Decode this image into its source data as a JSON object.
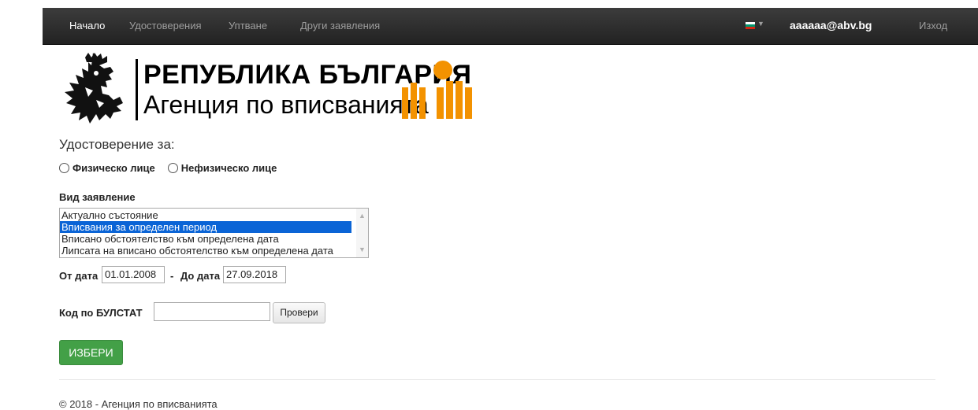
{
  "nav": {
    "items": [
      {
        "label": "Начало",
        "active": true
      },
      {
        "label": "Удостоверения",
        "active": false
      },
      {
        "label": "Уптване",
        "active": false
      },
      {
        "label": "Други заявления",
        "active": false
      }
    ],
    "language_flag": "bg-flag-icon",
    "user_email": "aaaaaa@abv.bg",
    "logout_label": "Изход"
  },
  "logo": {
    "line1": "РЕПУБЛИКА БЪЛГАРИЯ",
    "line2": "Агенция по вписванията"
  },
  "form": {
    "title": "Удостоверение за:",
    "radio_physical": "Физическо лице",
    "radio_nonphysical": "Нефизическо лице",
    "request_type_label": "Вид заявление",
    "request_types": [
      "Актуално състояние",
      "Вписвания за определен период",
      "Вписано обстоятелство към определена дата",
      "Липсата на вписано обстоятелство към определена дата"
    ],
    "selected_request_type": "Вписвания за определен период",
    "from_label": "От дата",
    "from_value": "01.01.2008",
    "separator": "-",
    "to_label": "До дата",
    "to_value": "27.09.2018",
    "bulstat_label": "Код по БУЛСТАТ",
    "bulstat_value": "",
    "check_button": "Провери",
    "choose_button": "ИЗБЕРИ"
  },
  "footer": {
    "text": "© 2018 - Агенция по вписванията"
  },
  "colors": {
    "navbar": "#222222",
    "selection": "#0a64d6",
    "primary_button": "#43a047",
    "brand_orange": "#f39200"
  }
}
